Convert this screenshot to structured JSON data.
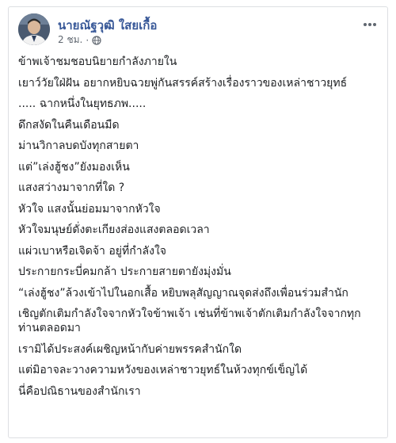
{
  "post": {
    "author_name": "นายณัฐวุฒิ ใสยเกื้อ",
    "timestamp": "2 ชม.",
    "privacy_icon": "globe-icon",
    "more_icon": "more-options-icon",
    "lines": [
      "ข้าพเจ้าชมชอบนิยายกำลังภายใน",
      "เยาว์วัยใฝ่ฝัน อยากหยิบฉวยพู่กันสรรค์สร้างเรื่องราวของเหล่าชาวยุทธ์",
      "..... ฉากหนึ่งในยุทธภพ.....",
      "ดึกสงัดในคืนเดือนมืด",
      "ม่านวิกาลบดบังทุกสายตา",
      "แต่”เล่งฮู้ชง”ยังมองเห็น",
      "แสงสว่างมาจากที่ใด ?",
      "หัวใจ แสงนั้นย่อมมาจากหัวใจ",
      "หัวใจมนุษย์ดั่งตะเกียงส่องแสงตลอดเวลา",
      "แผ่วเบาหรือเจิดจ้า อยู่ที่กำลังใจ",
      "ประกายกระบี่คมกล้า ประกายสายตายังมุ่งมั่น",
      "“เล่งฮู้ชง”ล้วงเข้าไปในอกเสื้อ หยิบพลุสัญญาณจุดส่งถึงเพื่อนร่วมสำนัก",
      "เชิญตักเติมกำลังใจจากหัวใจข้าพเจ้า เช่นที่ข้าพเจ้าตักเติมกำลังใจจากทุกท่านตลอดมา",
      "เรามิได้ประสงค์เผชิญหน้ากับค่ายพรรคสำนักใด",
      "แต่มิอาจละวางความหวังของเหล่าชาวยุทธ์ในห้วงทุกข์เข็ญได้",
      "นี่คือปณิธานของสำนักเรา"
    ]
  },
  "colors": {
    "author_link": "#385898",
    "meta_text": "#606770",
    "body_text": "#1c1e21",
    "border": "#dddfe2"
  }
}
